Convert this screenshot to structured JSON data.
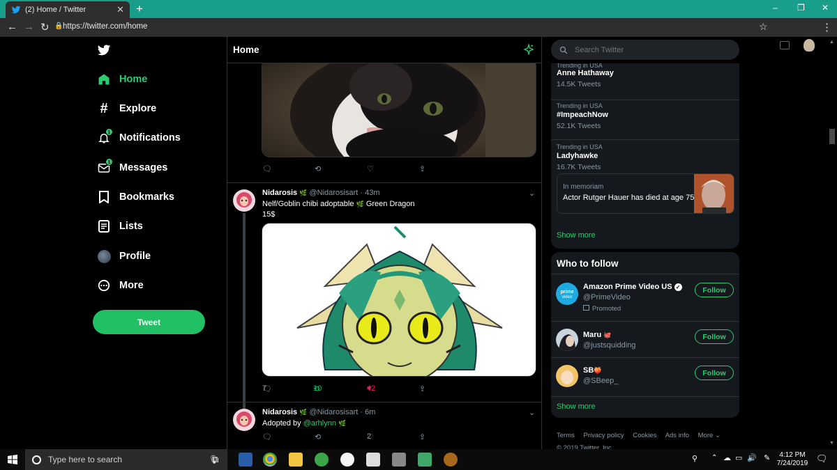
{
  "browser": {
    "tab_title": "(2) Home / Twitter",
    "tab_close": "✕",
    "new_tab": "+",
    "url": "https://twitter.com/home",
    "window_controls": [
      "–",
      "❐",
      "✕"
    ]
  },
  "nav": {
    "items": [
      {
        "label": "Home",
        "icon": "home-icon"
      },
      {
        "label": "Explore",
        "icon": "hashtag-icon"
      },
      {
        "label": "Notifications",
        "icon": "bell-icon",
        "badge": "1"
      },
      {
        "label": "Messages",
        "icon": "mail-icon",
        "badge": "1"
      },
      {
        "label": "Bookmarks",
        "icon": "bookmark-icon"
      },
      {
        "label": "Lists",
        "icon": "list-icon"
      },
      {
        "label": "Profile",
        "icon": "profile-avatar-icon"
      },
      {
        "label": "More",
        "icon": "more-icon"
      }
    ],
    "tweet_button": "Tweet"
  },
  "timeline": {
    "title": "Home",
    "prev_tweet_actions": {
      "reply": "",
      "retweet": "",
      "like": ""
    },
    "tweets": [
      {
        "name": "Nidarosis",
        "name_emoji": "🌿",
        "handle": "@Nidarosisart",
        "time": "· 43m",
        "text_line1": "Nelf/Goblin chibi adoptable",
        "text_line1_emoji": "🌿",
        "text_line1_end": "Green Dragon",
        "text_line2": "15$",
        "replies": "7",
        "retweets": "10",
        "likes": "42"
      },
      {
        "name": "Nidarosis",
        "name_emoji": "🌿",
        "handle": "@Nidarosisart",
        "time": "· 6m",
        "text": "Adopted by",
        "mention": "@arhlynn",
        "text_emoji": "🌿",
        "replies": "",
        "retweets": "",
        "likes": "2"
      }
    ]
  },
  "right": {
    "search_placeholder": "Search Twitter",
    "trends": [
      {
        "context": "Trending in USA",
        "name": "Anne Hathaway",
        "count": "14.5K Tweets"
      },
      {
        "context": "Trending in USA",
        "name": "#ImpeachNow",
        "count": "52.1K Tweets"
      },
      {
        "context": "Trending in USA",
        "name": "Ladyhawke",
        "count": "16.7K Tweets"
      }
    ],
    "memoriam_label": "In memoriam",
    "memoriam_text": "Actor Rutger Hauer has died at age 75",
    "show_more": "Show more",
    "who_to_follow_title": "Who to follow",
    "follow": [
      {
        "name": "Amazon Prime Video US",
        "handle": "@PrimeVideo",
        "promoted": "Promoted",
        "button": "Follow",
        "verified": true
      },
      {
        "name": "Maru",
        "name_emoji": "🐙",
        "handle": "@justsquidding",
        "button": "Follow"
      },
      {
        "name": "SB",
        "name_emoji": "🍑",
        "handle": "@SBeep_",
        "button": "Follow"
      }
    ],
    "footer": [
      "Terms",
      "Privacy policy",
      "Cookies",
      "Ads info",
      "More ⌄"
    ],
    "footer_copy": "© 2019 Twitter, Inc."
  },
  "taskbar": {
    "search_placeholder": "Type here to search",
    "time": "4:12 PM",
    "date": "7/24/2019"
  },
  "colors": {
    "accent": "#2ecc71",
    "tab_bar": "#1a9e8c",
    "like": "#e0245e"
  }
}
